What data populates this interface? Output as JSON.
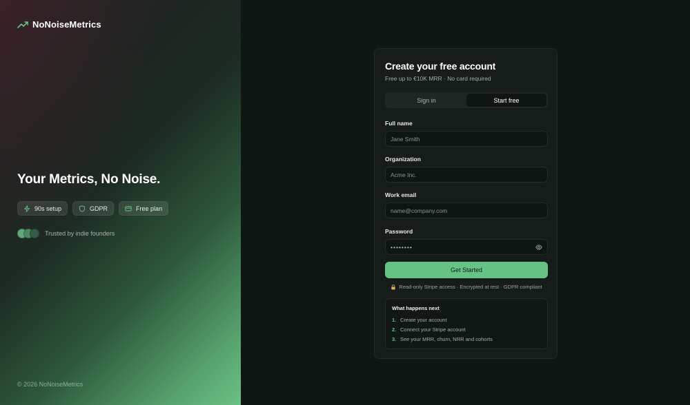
{
  "brand": {
    "name": "NoNoiseMetrics",
    "accent": "#66c383"
  },
  "hero": {
    "headline": "Your Metrics, No Noise.",
    "pills": [
      {
        "icon": "bolt-icon",
        "label": "90s setup"
      },
      {
        "icon": "shield-icon",
        "label": "GDPR"
      },
      {
        "icon": "credit-card-icon",
        "label": "Free plan"
      }
    ],
    "trusted": "Trusted by indie founders",
    "copyright": "© 2026 NoNoiseMetrics"
  },
  "card": {
    "title": "Create your free account",
    "subtitle": "Free up to €10K MRR · No card required",
    "tabs": [
      {
        "label": "Sign in",
        "active": false
      },
      {
        "label": "Start free",
        "active": true
      }
    ],
    "fields": {
      "full_name": {
        "label": "Full name",
        "placeholder": "Jane Smith",
        "value": ""
      },
      "organization": {
        "label": "Organization",
        "placeholder": "Acme Inc.",
        "value": ""
      },
      "email": {
        "label": "Work email",
        "placeholder": "name@company.com",
        "value": ""
      },
      "password": {
        "label": "Password",
        "value": "••••••••"
      }
    },
    "cta": "Get Started",
    "secure_note": "Read-only Stripe access · Encrypted at rest · GDPR compliant",
    "next": {
      "title": "What happens next",
      "steps": [
        {
          "num": "1.",
          "text": "Create your account"
        },
        {
          "num": "2.",
          "text": "Connect your Stripe account"
        },
        {
          "num": "3.",
          "text": "See your MRR, churn, NRR and cohorts"
        }
      ]
    }
  }
}
